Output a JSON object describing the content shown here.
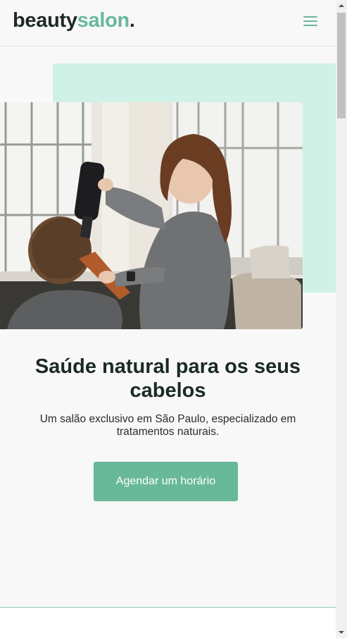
{
  "header": {
    "logo_part1": "beauty",
    "logo_part2": "salon",
    "logo_part3": ".",
    "menu_icon": "hamburger-menu-icon"
  },
  "hero": {
    "image_icon": "salon-hairdryer-photo",
    "headline": "Saúde natural para os seus cabelos",
    "subtext": "Um salão exclusivo em São Paulo, especializado em tratamentos naturais.",
    "cta_label": "Agendar um horário"
  },
  "colors": {
    "accent": "#68b89a",
    "accent_light": "#d0f2e6",
    "text_dark": "#1b2a26",
    "background": "#f8f8f8"
  }
}
